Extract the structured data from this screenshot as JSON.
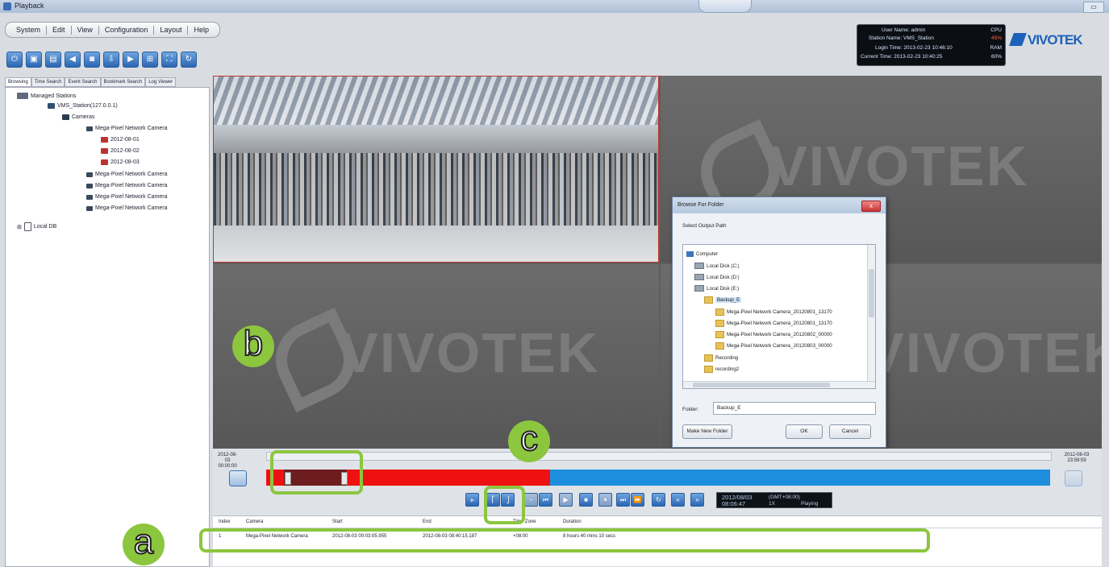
{
  "window": {
    "title": "Playback"
  },
  "menu": [
    "System",
    "Edit",
    "View",
    "Configuration",
    "Layout",
    "Help"
  ],
  "toolbar_icons": [
    "power-icon",
    "monitor-icon",
    "save-icon",
    "audio-icon",
    "snapshot-icon",
    "export-icon",
    "camera-icon",
    "layout-icon",
    "fullscreen-icon",
    "refresh-icon"
  ],
  "status": {
    "user": "User Name: admin",
    "station": "Station Name: VMS_Station",
    "login": "Login Time: 2013-02-23 10:46:10",
    "current": "Current Time: 2013-02-23 10:40:25",
    "cpu_label": "CPU",
    "cpu_val": "45%",
    "ram_label": "RAM",
    "ram_val": "60%"
  },
  "logo": "VIVOTEK",
  "side_tabs": [
    "Browsing",
    "Time Search",
    "Event Search",
    "Bookmark Search",
    "Log Viewer"
  ],
  "tree": {
    "root": "Managed Stations",
    "station": "VMS_Station(127.0.0.1)",
    "cameras": "Cameras",
    "cam_main": "Mega-Pixel Network Camera",
    "rec1": "2012-08-01",
    "rec2": "2012-08-02",
    "rec3": "2012-08-03",
    "cam_a": "Mega-Pixel Network Camera",
    "cam_b": "Mega-Pixel Network Camera",
    "cam_c": "Mega-Pixel Network Camera",
    "cam_d": "Mega-Pixel Network Camera",
    "local": "Local DB"
  },
  "watermark": "VIVOTEK",
  "dialog": {
    "title": "Browse For Folder",
    "close": "x",
    "prompt": "Select Output Path",
    "computer": "Computer",
    "c": "Local Disk (C:)",
    "d": "Local Disk (D:)",
    "e": "Local Disk (E:)",
    "backup": "Backup_E",
    "f1": "Mega-Pixel Network Camera_20120801_13170",
    "f2": "Mega-Pixel Network Camera_20120801_13170",
    "f3": "Mega-Pixel Network Camera_20120802_00000",
    "f4": "Mega-Pixel Network Camera_20120803_00000",
    "recording": "Recording",
    "recording2": "recording2",
    "folder_label": "Folder:",
    "folder_value": "Backup_E",
    "new_folder": "Make New Folder",
    "ok": "OK",
    "cancel": "Cancel"
  },
  "timeline": {
    "start_date": "2012-08-03",
    "start_time": "00:00:00",
    "end_date": "2012-08-03",
    "end_time": "23:59:59"
  },
  "playback_icons": [
    "bookmark-icon",
    "clip-start-icon",
    "clip-end-icon",
    "slower-icon",
    "prev-frame-icon",
    "play-icon",
    "stop-icon",
    "pause-icon",
    "next-frame-icon",
    "next-record-icon",
    "loop-icon",
    "rewind-icon",
    "forward-icon"
  ],
  "clock": {
    "date": "2012/08/03",
    "time": "08:06:47",
    "tz": "(GMT+08:00)",
    "speed": "1X",
    "mode": "Playing"
  },
  "results": {
    "headers": [
      "Index",
      "Camera",
      "Start",
      "End",
      "Time Zone",
      "Duration"
    ],
    "row": [
      "1",
      "Mega-Pixel Network Camera",
      "2012-08-03 00:03:05.955",
      "2012-08-03 08:40:15.187",
      "+08:00",
      "8 hours 40 mins 10 secs"
    ]
  },
  "annotations": {
    "a": "a",
    "b": "b",
    "c": "c"
  },
  "colors": {
    "highlight": "#8cc63f",
    "recorded": "#ee1111",
    "empty": "#1d8fde",
    "selected": "#6d1d1d"
  }
}
